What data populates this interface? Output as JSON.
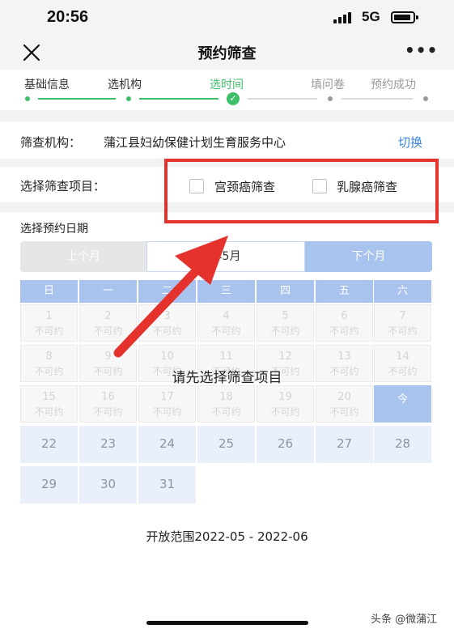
{
  "status_bar": {
    "time": "20:56",
    "network": "5G"
  },
  "nav": {
    "title": "预约筛查"
  },
  "steps": [
    {
      "label": "基础信息",
      "state": "done"
    },
    {
      "label": "选机构",
      "state": "done"
    },
    {
      "label": "选时间",
      "state": "current"
    },
    {
      "label": "填问卷",
      "state": "todo"
    },
    {
      "label": "预约成功",
      "state": "todo"
    }
  ],
  "org": {
    "label": "筛查机构：",
    "name": "蒲江县妇幼保健计划生育服务中心",
    "switch_label": "切换"
  },
  "items": {
    "label": "选择筛查项目：",
    "options": [
      {
        "label": "宫颈癌筛查",
        "checked": false
      },
      {
        "label": "乳腺癌筛查",
        "checked": false
      }
    ]
  },
  "calendar": {
    "title": "选择预约日期",
    "prev_label": "上个月",
    "current_month": "年5月",
    "next_label": "下个月",
    "weekdays": [
      "日",
      "一",
      "二",
      "三",
      "四",
      "五",
      "六"
    ],
    "unavailable_label": "不可约",
    "today_label": "今",
    "weeks": [
      [
        "1",
        "2",
        "3",
        "4",
        "5",
        "6",
        "7"
      ],
      [
        "8",
        "9",
        "10",
        "11",
        "12",
        "13",
        "14"
      ],
      [
        "15",
        "16",
        "17",
        "18",
        "19",
        "20",
        "今"
      ],
      [
        "22",
        "23",
        "24",
        "25",
        "26",
        "27",
        "28"
      ],
      [
        "29",
        "30",
        "31"
      ]
    ],
    "overlay_message": "请先选择筛查项目",
    "range_text": "开放范围2022-05 - 2022-06"
  },
  "watermark": "头条 @微蒲江",
  "colors": {
    "accent_green": "#3fbf6a",
    "link_blue": "#3a86e0",
    "calendar_blue": "#a9c3ef",
    "annotation_red": "#e5322d"
  }
}
